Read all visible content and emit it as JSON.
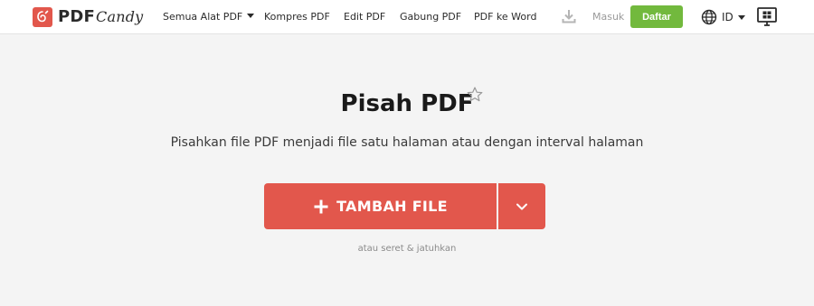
{
  "header": {
    "logo": {
      "word1": "PDF",
      "word2": "Candy"
    },
    "nav": [
      {
        "label": "Semua Alat PDF",
        "has_dropdown": true
      },
      {
        "label": "Kompres PDF"
      },
      {
        "label": "Edit PDF"
      },
      {
        "label": "Gabung PDF"
      },
      {
        "label": "PDF ke Word"
      }
    ],
    "download_icon": "download-icon",
    "login_label": "Masuk",
    "signup_label": "Daftar",
    "language": {
      "icon": "globe-icon",
      "code": "ID"
    },
    "desktop_icon": "windows-desktop-icon"
  },
  "main": {
    "title": "Pisah PDF",
    "favorite_icon": "star-icon",
    "subtitle": "Pisahkan file PDF menjadi file satu halaman atau dengan interval halaman",
    "add_file_label": "TAMBAH FILE",
    "add_icon": "plus-icon",
    "dropdown_icon": "chevron-down-icon",
    "hint": "atau seret & jatuhkan"
  },
  "colors": {
    "brand": "#e2574c",
    "signup": "#72b93d",
    "background": "#f4f4f4"
  }
}
